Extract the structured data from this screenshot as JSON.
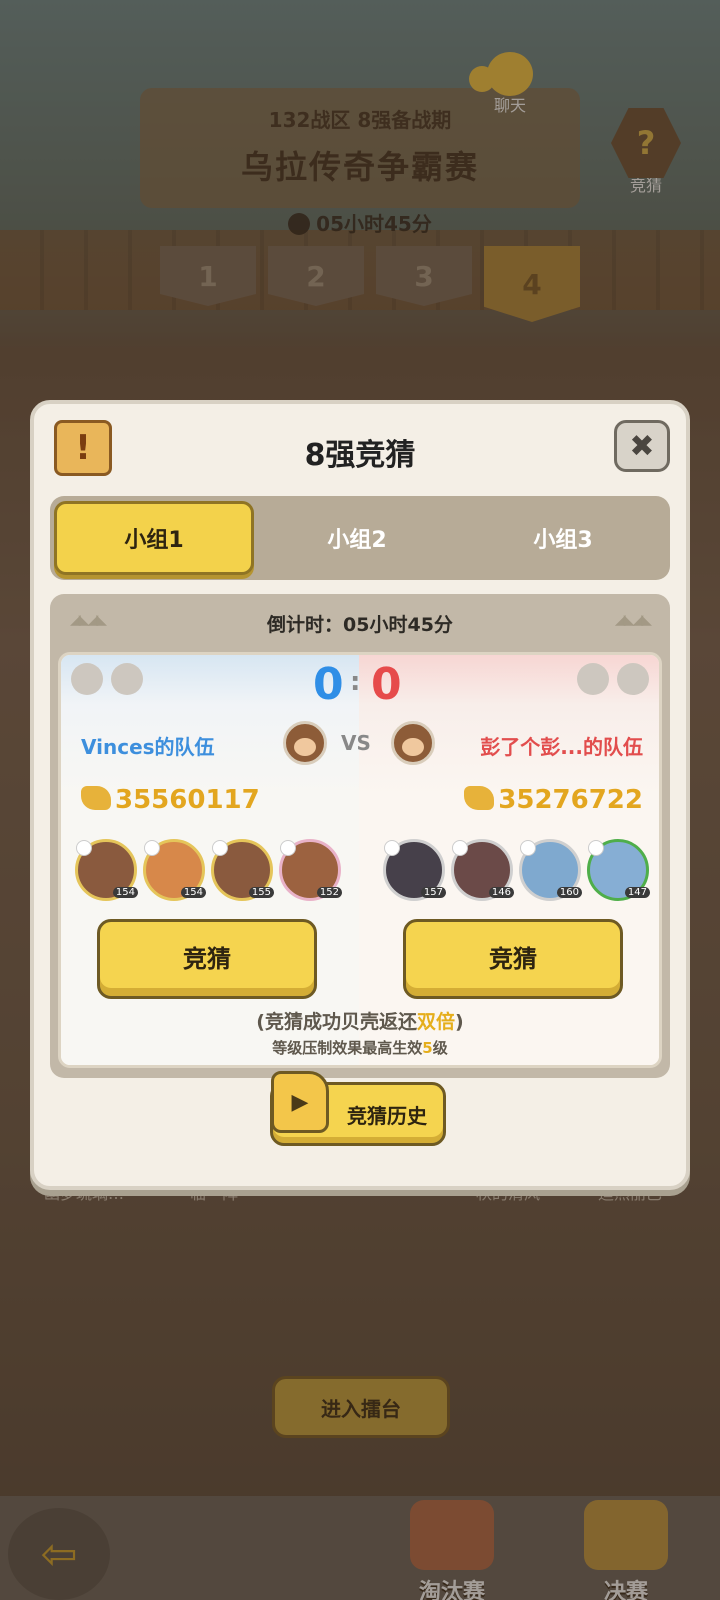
{
  "header": {
    "subtitle": "132战区 8强备战期",
    "title": "乌拉传奇争霸赛",
    "timer": "05小时45分",
    "stage_tabs": [
      "1",
      "2",
      "3",
      "4"
    ],
    "active_stage": "4"
  },
  "top_buttons": {
    "chat_label": "聊天",
    "guess_label": "竞猜"
  },
  "background_names": [
    "幽梦琉璃…",
    "临一阵",
    "秋的清风",
    "迪热丽巴"
  ],
  "enter_arena": "进入擂台",
  "bottom_nav": {
    "elimination": "淘汰赛",
    "final": "决赛"
  },
  "modal": {
    "title": "8强竞猜",
    "close_icon": "✖",
    "group_tabs": [
      "小组1",
      "小组2",
      "小组3"
    ],
    "active_group": "小组1",
    "countdown": "倒计时：05小时45分",
    "score_left": "0",
    "score_right": "0",
    "vs": "VS",
    "left_team": {
      "name": "Vinces的队伍",
      "power": "35560117",
      "hero_levels": [
        "154",
        "154",
        "155",
        "152"
      ]
    },
    "right_team": {
      "name": "彭了个彭...的队伍",
      "power": "35276722",
      "hero_levels": [
        "157",
        "146",
        "160",
        "147"
      ]
    },
    "bet_label": "竞猜",
    "note1_pre": "(竞猜成功贝壳返还",
    "note1_hl": "双倍",
    "note1_post": ")",
    "note2_pre": "等级压制效果最高生效",
    "note2_hl": "5",
    "note2_post": "级",
    "history_label": "竞猜历史"
  },
  "colors": {
    "accent_yellow": "#f5d44f",
    "team_blue": "#2f8ee6",
    "team_red": "#e64b4b",
    "power_gold": "#e3a61f"
  }
}
